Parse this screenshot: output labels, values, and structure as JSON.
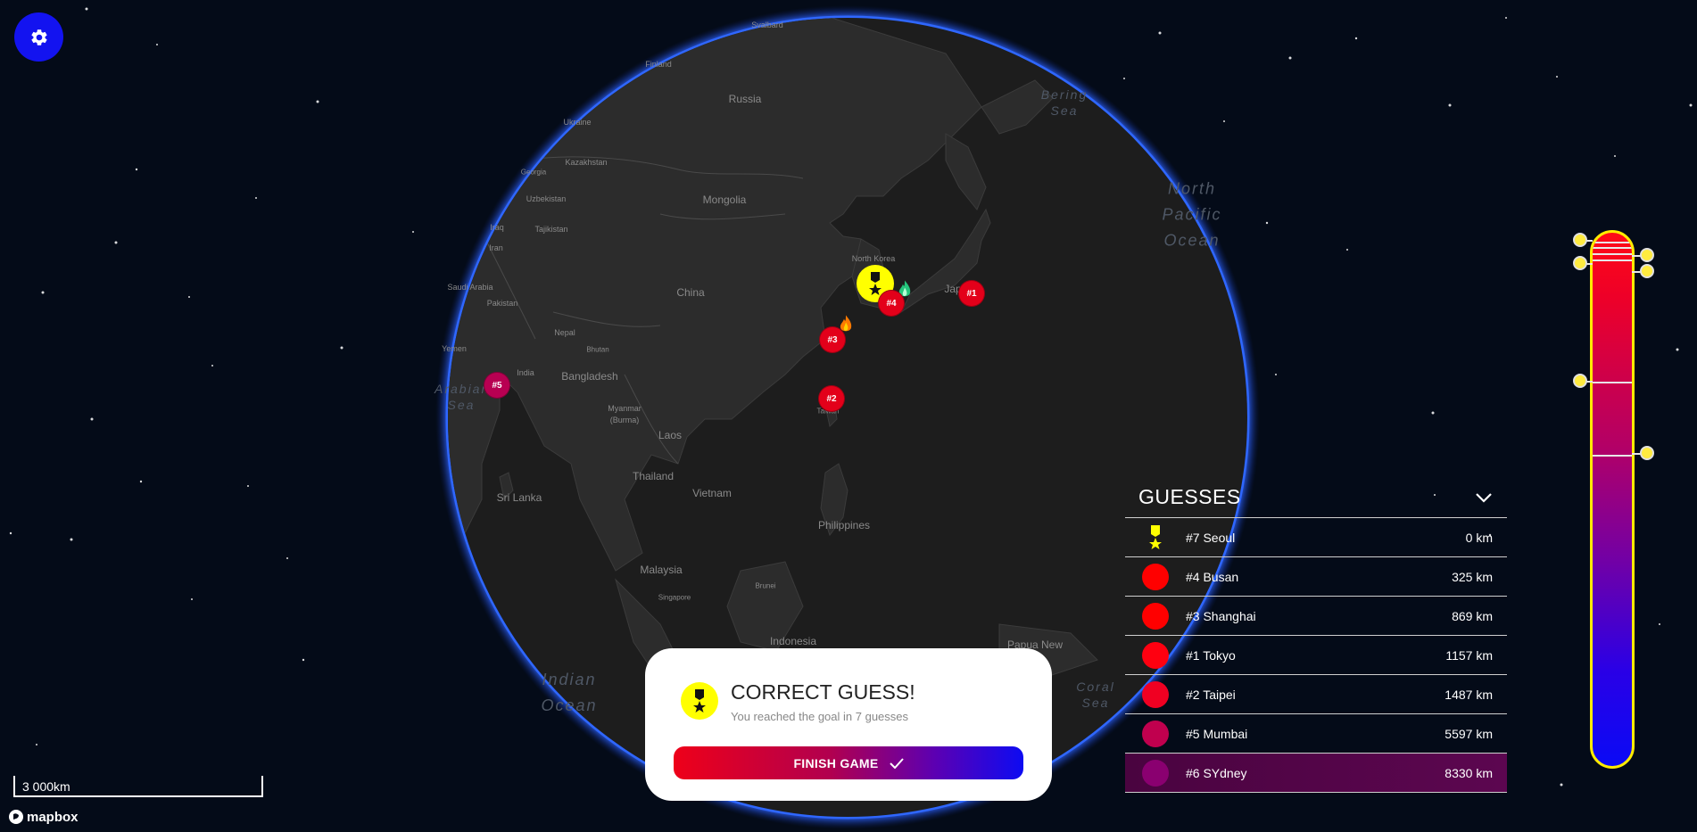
{
  "map": {
    "countries": [
      "Svalbard",
      "Finland",
      "Russia",
      "Ukraine",
      "Georgia",
      "Kazakhstan",
      "Uzbekistan",
      "Mongolia",
      "Iraq",
      "Tajikistan",
      "Iran",
      "North Korea",
      "Saudi Arabia",
      "China",
      "Pakistan",
      "Nepal",
      "Yemen",
      "India",
      "Bhutan",
      "Bangladesh",
      "Myanmar (Burma)",
      "Laos",
      "Thailand",
      "Vietnam",
      "Sri Lanka",
      "Philippines",
      "Malaysia",
      "Singapore",
      "Brunei",
      "Indonesia",
      "Papua New",
      "Taiwan",
      "Jap"
    ],
    "oceans": [
      "North Pacific Ocean",
      "Bering Sea",
      "Arabian Sea",
      "Indian Ocean",
      "Coral Sea"
    ]
  },
  "pins": [
    {
      "label": "#1",
      "color": "#e3001a"
    },
    {
      "label": "#2",
      "color": "#e3001a"
    },
    {
      "label": "#3",
      "color": "#e3001a"
    },
    {
      "label": "#4",
      "color": "#e3001a"
    },
    {
      "label": "#5",
      "color": "#b80052"
    }
  ],
  "goal_marker": {
    "icon": "medal-icon",
    "color": "#ffff00"
  },
  "settings_button": {
    "icon": "gear-icon",
    "color": "#1313f0"
  },
  "guesses": {
    "title": "GUESSES",
    "collapse_icon": "chevron-down-icon",
    "rows": [
      {
        "name": "#7 Seoul",
        "distance": "0 km",
        "icon": "medal-icon",
        "color": "#ffff00"
      },
      {
        "name": "#4 Busan",
        "distance": "325 km",
        "color": "#ff0000"
      },
      {
        "name": "#3 Shanghai",
        "distance": "869 km",
        "color": "#ff0000"
      },
      {
        "name": "#1 Tokyo",
        "distance": "1157 km",
        "color": "#ff0010"
      },
      {
        "name": "#2 Taipei",
        "distance": "1487 km",
        "color": "#f00022"
      },
      {
        "name": "#5 Mumbai",
        "distance": "5597 km",
        "color": "#c0004e"
      },
      {
        "name": "#6 SYdney",
        "distance": "8330 km",
        "color": "#8a0070"
      }
    ]
  },
  "result": {
    "title": "CORRECT GUESS!",
    "subtitle": "You reached the goal in 7 guesses",
    "button_label": "FINISH GAME",
    "button_icon": "check-icon"
  },
  "scale": {
    "label": "3 000km"
  },
  "attribution": {
    "label": "mapbox"
  },
  "colors": {
    "accent_blue": "#1313f0",
    "hot": "#ee0019",
    "cold": "#0d0bf2",
    "thermometer_border": "#ffeb00"
  }
}
